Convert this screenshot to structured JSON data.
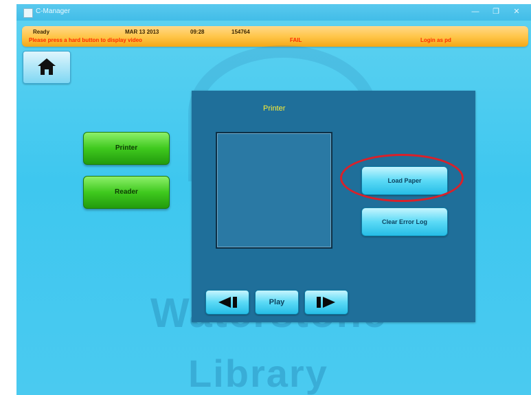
{
  "window": {
    "title": "C-Manager",
    "controls": [
      "—",
      "❐",
      "✕"
    ]
  },
  "statusbar": {
    "state": "Ready",
    "date": "MAR 13 2013",
    "time": "09:28",
    "number": "154764",
    "hint": "Please press a hard button to display video",
    "alert": "FAIL",
    "login": "Login as pd"
  },
  "sidebar": {
    "buttons": [
      {
        "label": "Printer"
      },
      {
        "label": "Reader"
      }
    ]
  },
  "panel": {
    "title": "Printer",
    "actions": {
      "primary": "Load Paper",
      "secondary": "Clear Error Log"
    },
    "playback": {
      "play_label": "Play"
    }
  },
  "watermark": {
    "line1": "Waterstone",
    "line2": "Library"
  },
  "colors": {
    "highlight": "#d9212a",
    "panel_bg": "#1f6f9a",
    "status_bg": "#ffc64a",
    "title_yellow": "#ffef33"
  }
}
